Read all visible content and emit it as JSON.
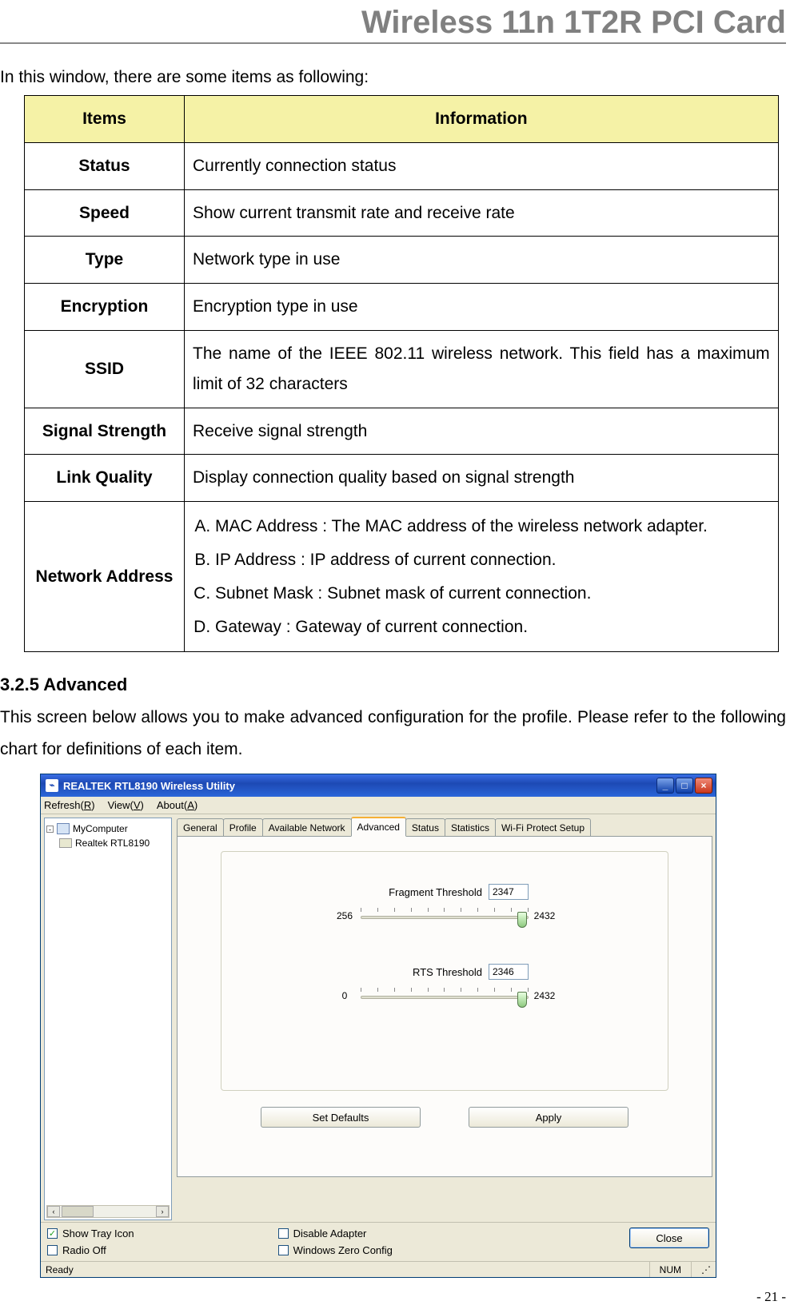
{
  "header": {
    "title": "Wireless 11n 1T2R PCI Card"
  },
  "intro": "In this window, there are some items as following:",
  "table": {
    "head_items": "Items",
    "head_info": "Information",
    "rows": [
      {
        "item": "Status",
        "info": "Currently connection status"
      },
      {
        "item": "Speed",
        "info": "Show current transmit rate and receive rate"
      },
      {
        "item": "Type",
        "info": "Network type in use"
      },
      {
        "item": "Encryption",
        "info": "Encryption type in use"
      },
      {
        "item": "SSID",
        "info": "The name of the IEEE 802.11 wireless network. This field has a maximum limit of 32 characters"
      },
      {
        "item": "Signal Strength",
        "info": "Receive signal strength"
      },
      {
        "item": "Link Quality",
        "info": "Display connection quality based on signal strength"
      }
    ],
    "net_item": "Network Address",
    "net_list": {
      "a": "MAC Address : The MAC address of the wireless network adapter.",
      "b": "IP Address : IP address of current connection.",
      "c": "Subnet Mask : Subnet mask of current connection.",
      "d": "Gateway : Gateway of current connection."
    }
  },
  "section": {
    "heading": "3.2.5  Advanced",
    "text": "This screen below allows you to make advanced configuration for the profile. Please refer to the following chart for definitions of each item."
  },
  "app": {
    "title": "REALTEK RTL8190 Wireless Utility",
    "menu": {
      "refresh": "Refresh(R)",
      "view": "View(V)",
      "about": "About(A)"
    },
    "tree": {
      "root": "MyComputer",
      "adapter": "Realtek RTL8190"
    },
    "tabs": {
      "general": "General",
      "profile": "Profile",
      "avail": "Available Network",
      "advanced": "Advanced",
      "status": "Status",
      "stats": "Statistics",
      "wps": "Wi-Fi Protect Setup"
    },
    "frag": {
      "label": "Fragment Threshold",
      "value": "2347",
      "min": "256",
      "max": "2432"
    },
    "rts": {
      "label": "RTS Threshold",
      "value": "2346",
      "min": "0",
      "max": "2432"
    },
    "buttons": {
      "defaults": "Set Defaults",
      "apply": "Apply",
      "close": "Close"
    },
    "opts": {
      "tray": "Show Tray Icon",
      "radio": "Radio Off",
      "disable": "Disable Adapter",
      "wzc": "Windows Zero Config"
    },
    "status_ready": "Ready",
    "status_num": "NUM"
  },
  "page_num": "- 21 -"
}
